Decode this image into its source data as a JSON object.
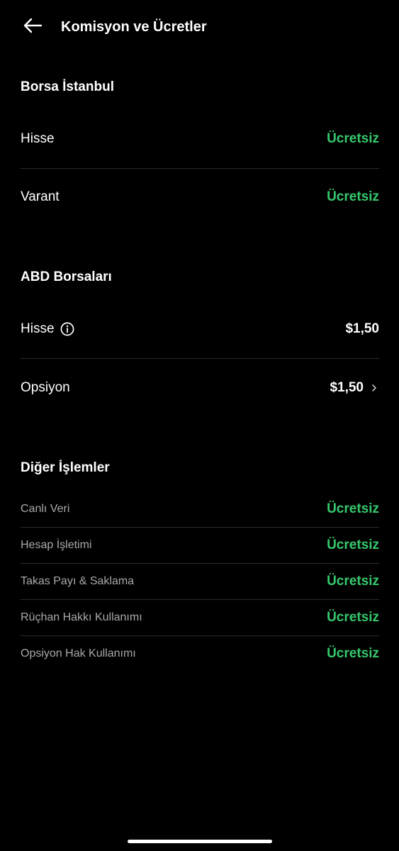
{
  "colors": {
    "background": "#000000",
    "accent_green": "#36c96d",
    "text_primary": "#ffffff",
    "text_secondary": "#a9a9ad",
    "divider": "#2a2a2e"
  },
  "header": {
    "back_icon": "arrow-left-icon",
    "title": "Komisyon ve Ücretler"
  },
  "sections": {
    "borsa_istanbul": {
      "title": "Borsa İstanbul",
      "items": [
        {
          "label": "Hisse",
          "value": "Ücretsiz"
        },
        {
          "label": "Varant",
          "value": "Ücretsiz"
        }
      ]
    },
    "abd_borsalari": {
      "title": "ABD Borsaları",
      "items": [
        {
          "label": "Hisse",
          "value": "$1,50",
          "icon": "info-icon"
        },
        {
          "label": "Opsiyon",
          "value": "$1,50",
          "icon": "chevron-right-icon"
        }
      ]
    },
    "diger_islemler": {
      "title": "Diğer İşlemler",
      "items": [
        {
          "label": "Canlı Veri",
          "value": "Ücretsiz"
        },
        {
          "label": "Hesap İşletimi",
          "value": "Ücretsiz"
        },
        {
          "label": "Takas Payı & Saklama",
          "value": "Ücretsiz"
        },
        {
          "label": "Rüçhan Hakkı Kullanımı",
          "value": "Ücretsiz"
        },
        {
          "label": "Opsiyon Hak Kullanımı",
          "value": "Ücretsiz"
        }
      ]
    }
  }
}
